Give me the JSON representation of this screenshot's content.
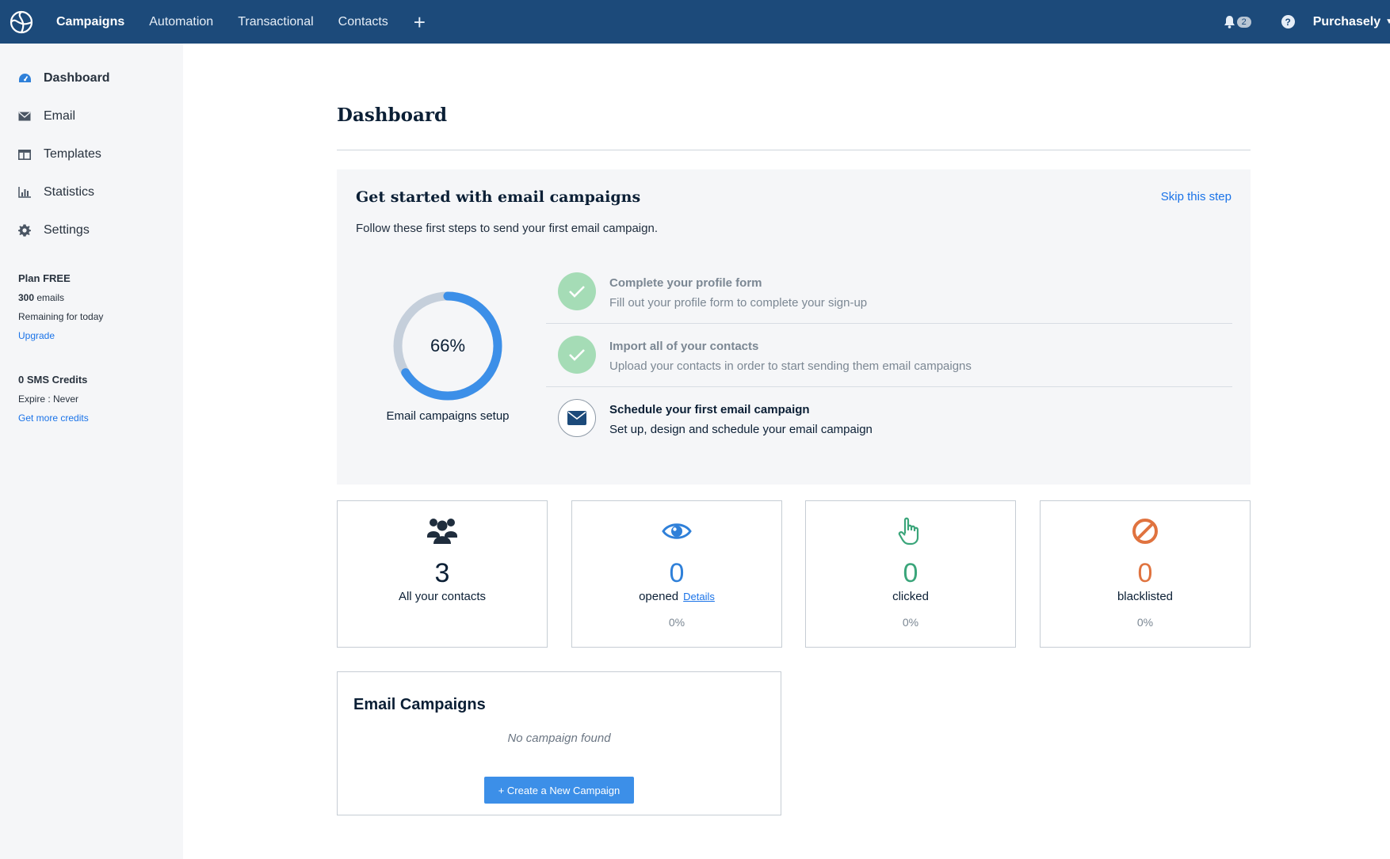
{
  "topnav": {
    "items": [
      "Campaigns",
      "Automation",
      "Transactional",
      "Contacts"
    ],
    "plus": "+",
    "notification_count": "2",
    "help": "?",
    "account": "Purchasely"
  },
  "sidebar": {
    "items": [
      {
        "label": "Dashboard",
        "icon": "dashboard-icon"
      },
      {
        "label": "Email",
        "icon": "envelope-icon"
      },
      {
        "label": "Templates",
        "icon": "templates-icon"
      },
      {
        "label": "Statistics",
        "icon": "chart-icon"
      },
      {
        "label": "Settings",
        "icon": "gear-icon"
      }
    ],
    "plan": {
      "title": "Plan FREE",
      "emails_count": "300",
      "emails_unit": " emails",
      "remaining": "Remaining for today",
      "upgrade": "Upgrade"
    },
    "sms": {
      "title": "0 SMS Credits",
      "expire": "Expire : Never",
      "more": "Get more credits"
    }
  },
  "page": {
    "title": "Dashboard"
  },
  "onboarding": {
    "title": "Get started with email campaigns",
    "subtitle": "Follow these first steps to send your first email campaign.",
    "skip": "Skip this step",
    "progress_percent": 66,
    "progress_label": "66%",
    "progress_caption": "Email campaigns setup",
    "steps": [
      {
        "title": "Complete your profile form",
        "desc": "Fill out your profile form to complete your sign-up",
        "done": true
      },
      {
        "title": "Import all of your contacts",
        "desc": "Upload your contacts in order to start sending them email campaigns",
        "done": true
      },
      {
        "title": "Schedule your first email campaign",
        "desc": "Set up, design and schedule your email campaign",
        "done": false
      }
    ]
  },
  "stats": [
    {
      "value": "3",
      "label": "All your contacts",
      "pct": "",
      "color": "#0b1f35",
      "icon": "users-icon"
    },
    {
      "value": "0",
      "label": "opened",
      "details": "Details",
      "pct": "0%",
      "color": "#2f80d9",
      "icon": "eye-icon"
    },
    {
      "value": "0",
      "label": "clicked",
      "pct": "0%",
      "color": "#3aa57a",
      "icon": "pointer-hand-icon"
    },
    {
      "value": "0",
      "label": "blacklisted",
      "pct": "0%",
      "color": "#e0733f",
      "icon": "blocked-icon"
    }
  ],
  "campaigns": {
    "title": "Email Campaigns",
    "empty": "No campaign found",
    "button": "+ Create a New Campaign"
  },
  "colors": {
    "topbar": "#1c4a7a",
    "accent": "#3c8fe8",
    "done_green": "#a5dcb6"
  }
}
